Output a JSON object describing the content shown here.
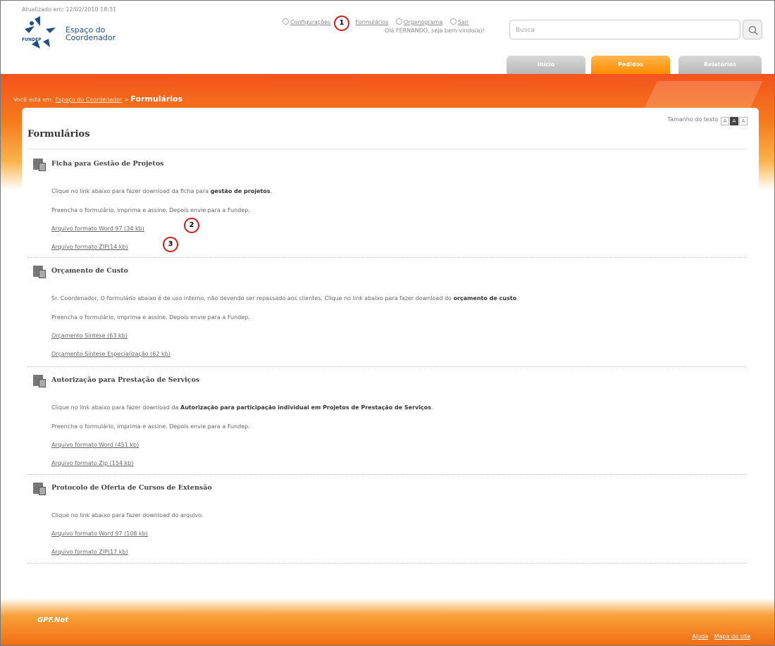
{
  "header": {
    "updated": "Atualizado em: 12/02/2010 18:31",
    "logo_name": "FUNDEP",
    "logo_line1": "Espaço do",
    "logo_line2": "Coordenador",
    "links": [
      "Configurações",
      "Formulários",
      "Organograma",
      "Sair"
    ],
    "greeting": "Olá FERNANDO, seja bem-vindo(a)!",
    "search_placeholder": "Busca"
  },
  "tabs": [
    {
      "label": "Início",
      "active": false
    },
    {
      "label": "Pedidos",
      "active": true
    },
    {
      "label": "Relatórios",
      "active": false
    }
  ],
  "breadcrumb": {
    "prefix": "Você está em:",
    "link": "Espaço do Coordenador",
    "separator": ">",
    "current": "Formulários"
  },
  "text_size": {
    "label": "Tamanho do texto",
    "options": [
      "A",
      "A",
      "A"
    ],
    "active_index": 1
  },
  "page_title": "Formulários",
  "sections": [
    {
      "title": "Ficha para Gestão de Projetos",
      "intro_pre": "Clique no link abaixo para fazer download da ficha para ",
      "intro_bold": "gestão de projetos",
      "intro_post": ".",
      "instruction": "Preencha o formulário, imprima e assine. Depois envie para a Fundep.",
      "links": [
        "Arquivo formato Word 97 (34 kb)",
        "Arquivo formato ZIP(14 kb)"
      ]
    },
    {
      "title": "Orçamento de Custo",
      "intro_pre": "Sr. Coordenador, O formulário abaixo é de uso interno, não devendo ser repassado aos clientes. Clique no link abaixo para fazer download do ",
      "intro_bold": "orçamento de custo",
      "intro_post": ".",
      "instruction": "Preencha o formulário, imprima e assine. Depois envie para a Fundep.",
      "links": [
        "Orçamento Síntese (63 kb)",
        "Orçamento Síntese Especialização (62 kb)"
      ]
    },
    {
      "title": "Autorização para Prestação de Serviços",
      "intro_pre": "Clique no link abaixo para fazer download da ",
      "intro_bold": "Autorização para participação individual em Projetos de Prestação de Serviços",
      "intro_post": ".",
      "instruction": "Preencha o formulário, imprima e assine. Depois envie para a Fundep.",
      "links": [
        "Arquivo formato Word (451 kb)",
        "Arquivo formato Zip (154 kb)"
      ]
    },
    {
      "title": "Protocolo de Oferta de Cursos de Extensão",
      "intro_pre": "Clique no link abaixo para fazer download do arquivo.",
      "intro_bold": "",
      "intro_post": "",
      "instruction": "",
      "links": [
        "Arquivo formato Word 97 (108 kb)",
        "Arquivo formato ZIP(17 kb)"
      ]
    }
  ],
  "badges": [
    "1",
    "2",
    "3"
  ],
  "footer": {
    "brand": "GPF.Net",
    "links": [
      "Ajuda",
      "Mapa do site"
    ]
  },
  "colors": {
    "orange": "#f47a1b",
    "badge_red": "#d51c1c"
  }
}
